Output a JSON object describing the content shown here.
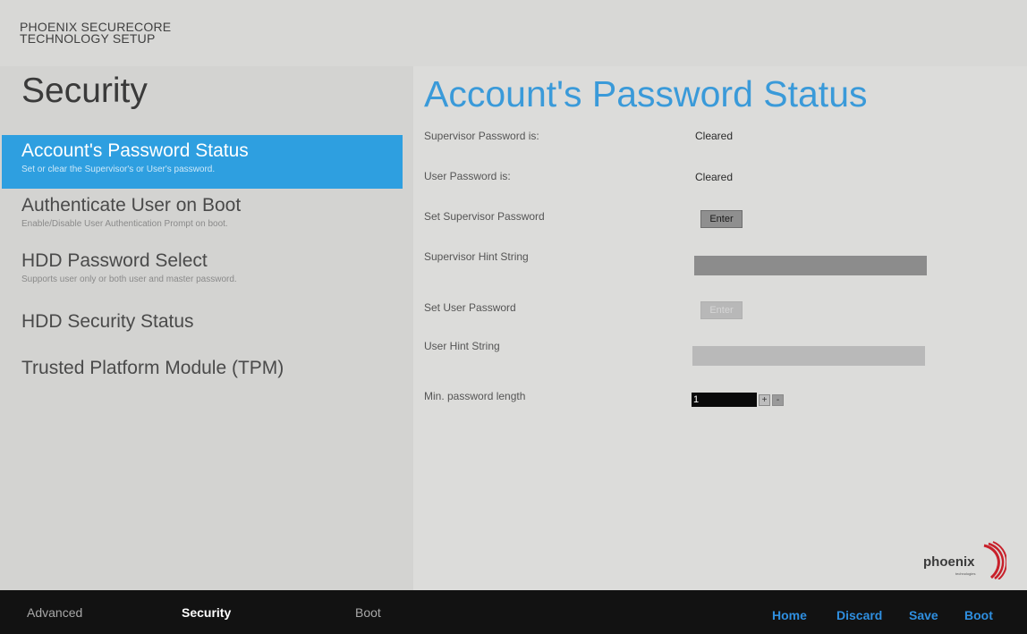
{
  "header": {
    "brand_line1": "PHOENIX SECURECORE",
    "brand_line2": "TECHNOLOGY SETUP"
  },
  "sidebar": {
    "title": "Security",
    "items": [
      {
        "label": "Account's Password Status",
        "desc": "Set or clear the Supervisor's or User's password.",
        "active": true
      },
      {
        "label": "Authenticate User on Boot",
        "desc": "Enable/Disable User Authentication Prompt on boot."
      },
      {
        "label": "HDD Password Select",
        "desc": "Supports user only or both user and master password."
      },
      {
        "label": "HDD Security Status",
        "desc": ""
      },
      {
        "label": "Trusted Platform Module (TPM)",
        "desc": ""
      }
    ]
  },
  "main": {
    "title": "Account's Password Status",
    "supervisor_password_label": "Supervisor Password is:",
    "supervisor_password_value": "Cleared",
    "user_password_label": "User Password is:",
    "user_password_value": "Cleared",
    "set_supervisor_label": "Set Supervisor Password",
    "set_supervisor_button": "Enter",
    "supervisor_hint_label": "Supervisor Hint String",
    "supervisor_hint_value": "",
    "set_user_label": "Set User Password",
    "set_user_button": "Enter",
    "user_hint_label": "User Hint String",
    "user_hint_value": "",
    "min_length_label": "Min. password length",
    "min_length_value": "1",
    "stepper_plus": "+",
    "stepper_minus": "-"
  },
  "logo": {
    "text": "phoenix",
    "tagline": "technologies"
  },
  "bottom_bar": {
    "tabs": [
      {
        "label": "Advanced"
      },
      {
        "label": "Security",
        "active": true
      },
      {
        "label": "Boot"
      }
    ],
    "actions": [
      {
        "label": "Home"
      },
      {
        "label": "Discard"
      },
      {
        "label": "Save"
      },
      {
        "label": "Boot"
      }
    ]
  },
  "colors": {
    "accent": "#2e9fe0",
    "title_blue": "#3a9ad9",
    "action_blue": "#2f8fe0",
    "background": "#d8d8d6",
    "bottom_bar": "#121212"
  }
}
